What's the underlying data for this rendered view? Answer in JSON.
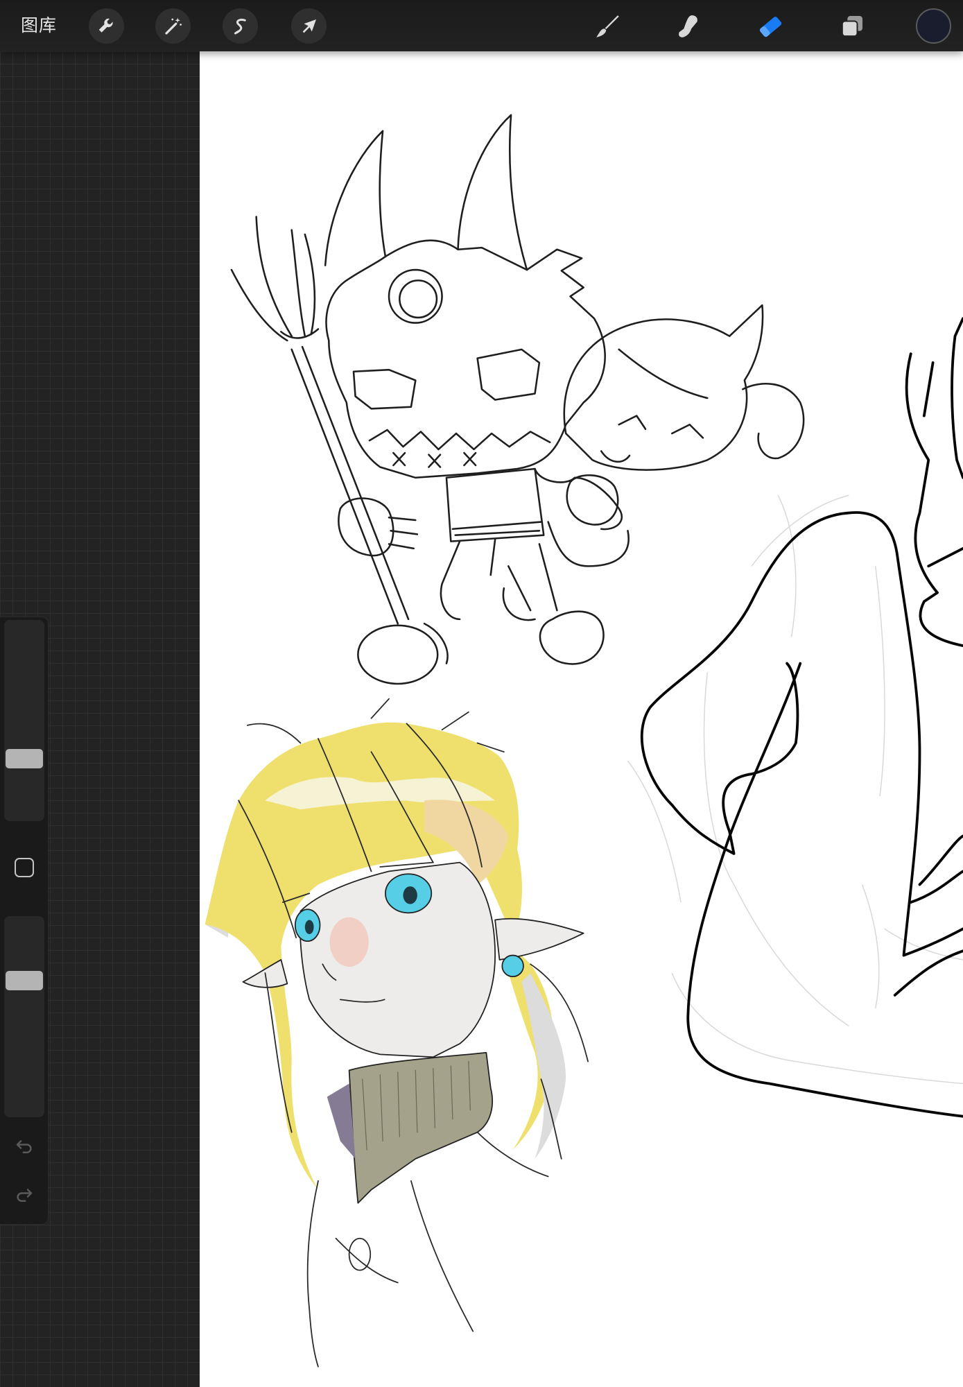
{
  "toolbar": {
    "gallery_label": "图库",
    "left_actions": [
      {
        "icon": "wrench-icon"
      },
      {
        "icon": "magic-wand-icon"
      },
      {
        "icon": "selection-icon"
      },
      {
        "icon": "transform-arrow-icon"
      }
    ],
    "tools": [
      {
        "icon": "brush-icon",
        "active": false
      },
      {
        "icon": "smudge-icon",
        "active": false
      },
      {
        "icon": "eraser-icon",
        "active": true
      },
      {
        "icon": "layers-icon",
        "active": false
      }
    ],
    "current_color": "#1a1d2e"
  },
  "sidebar": {
    "brush_size": 0.31,
    "opacity": 0.68,
    "modify_icon": "square-icon",
    "undo_icon": "undo-icon",
    "redo_icon": "redo-icon"
  },
  "colors": {
    "accent": "#1a7cf5",
    "icon": "#e2e2e2",
    "canvas": "#ffffff",
    "hair": "#efe06e",
    "eyes": "#56cfe6",
    "sweater": "#a4a28a"
  }
}
